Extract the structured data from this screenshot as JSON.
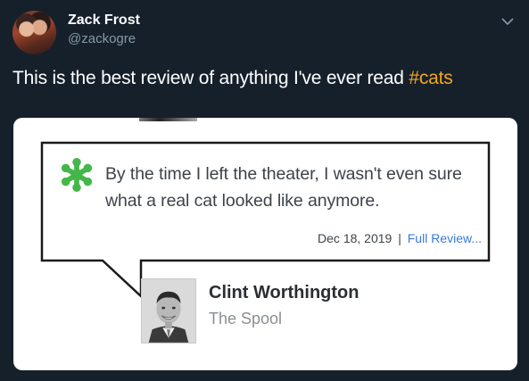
{
  "tweet": {
    "display_name": "Zack Frost",
    "handle": "@zackogre",
    "text": "This is the best review of anything I've ever read ",
    "hashtag": "#cats"
  },
  "colors": {
    "background": "#15202b",
    "hashtag": "#f5a623",
    "handle": "#8899a6",
    "star": "#45b64a",
    "link": "#3a7bd5"
  },
  "review": {
    "quote": "By the time I left the theater, I wasn't even sure what a real cat looked like anymore.",
    "date": "Dec 18, 2019",
    "separator": "|",
    "link_label": "Full Review...",
    "critic_name": "Clint Worthington",
    "outlet": "The Spool"
  },
  "icons": {
    "menu": "chevron-down-icon",
    "review_badge": "green-splat-icon"
  }
}
